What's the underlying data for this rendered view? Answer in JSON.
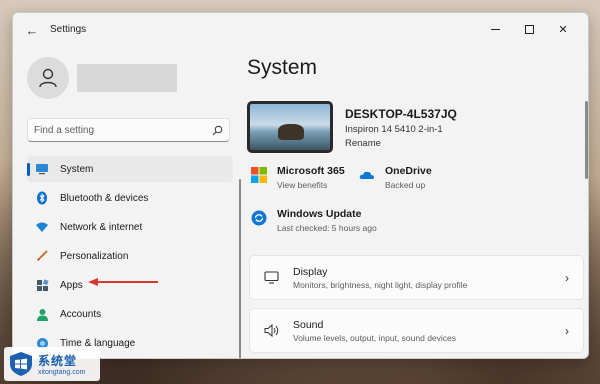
{
  "window": {
    "title": "Settings",
    "back_glyph": "←",
    "controls": {
      "minimize": "minimize",
      "maximize": "maximize",
      "close": "✕"
    }
  },
  "search": {
    "placeholder": "Find a setting",
    "icon": "search-icon"
  },
  "sidebar": {
    "items": [
      {
        "label": "System",
        "icon": "system-icon",
        "selected": true
      },
      {
        "label": "Bluetooth & devices",
        "icon": "bluetooth-icon",
        "selected": false
      },
      {
        "label": "Network & internet",
        "icon": "wifi-icon",
        "selected": false
      },
      {
        "label": "Personalization",
        "icon": "brush-icon",
        "selected": false
      },
      {
        "label": "Apps",
        "icon": "apps-icon",
        "selected": false
      },
      {
        "label": "Accounts",
        "icon": "accounts-icon",
        "selected": false
      },
      {
        "label": "Time & language",
        "icon": "globe-icon",
        "selected": false
      }
    ]
  },
  "main": {
    "title": "System",
    "device": {
      "name": "DESKTOP-4L537JQ",
      "model": "Inspiron 14 5410 2-in-1",
      "rename": "Rename"
    },
    "quick": [
      {
        "title": "Microsoft 365",
        "subtitle": "View benefits",
        "icon": "microsoft-365-icon"
      },
      {
        "title": "OneDrive",
        "subtitle": "Backed up",
        "icon": "onedrive-icon"
      },
      {
        "title": "Windows Update",
        "subtitle": "Last checked: 5 hours ago",
        "icon": "windows-update-icon"
      }
    ],
    "cards": [
      {
        "title": "Display",
        "subtitle": "Monitors, brightness, night light, display profile",
        "icon": "display-icon"
      },
      {
        "title": "Sound",
        "subtitle": "Volume levels, output, input, sound devices",
        "icon": "sound-icon"
      }
    ],
    "chevron": "›"
  },
  "watermark": {
    "name": "系统堂",
    "url": "xitongtang.com"
  },
  "colors": {
    "accent": "#005fb8",
    "annotation_arrow": "#d9372b",
    "watermark": "#1d5fb0"
  }
}
